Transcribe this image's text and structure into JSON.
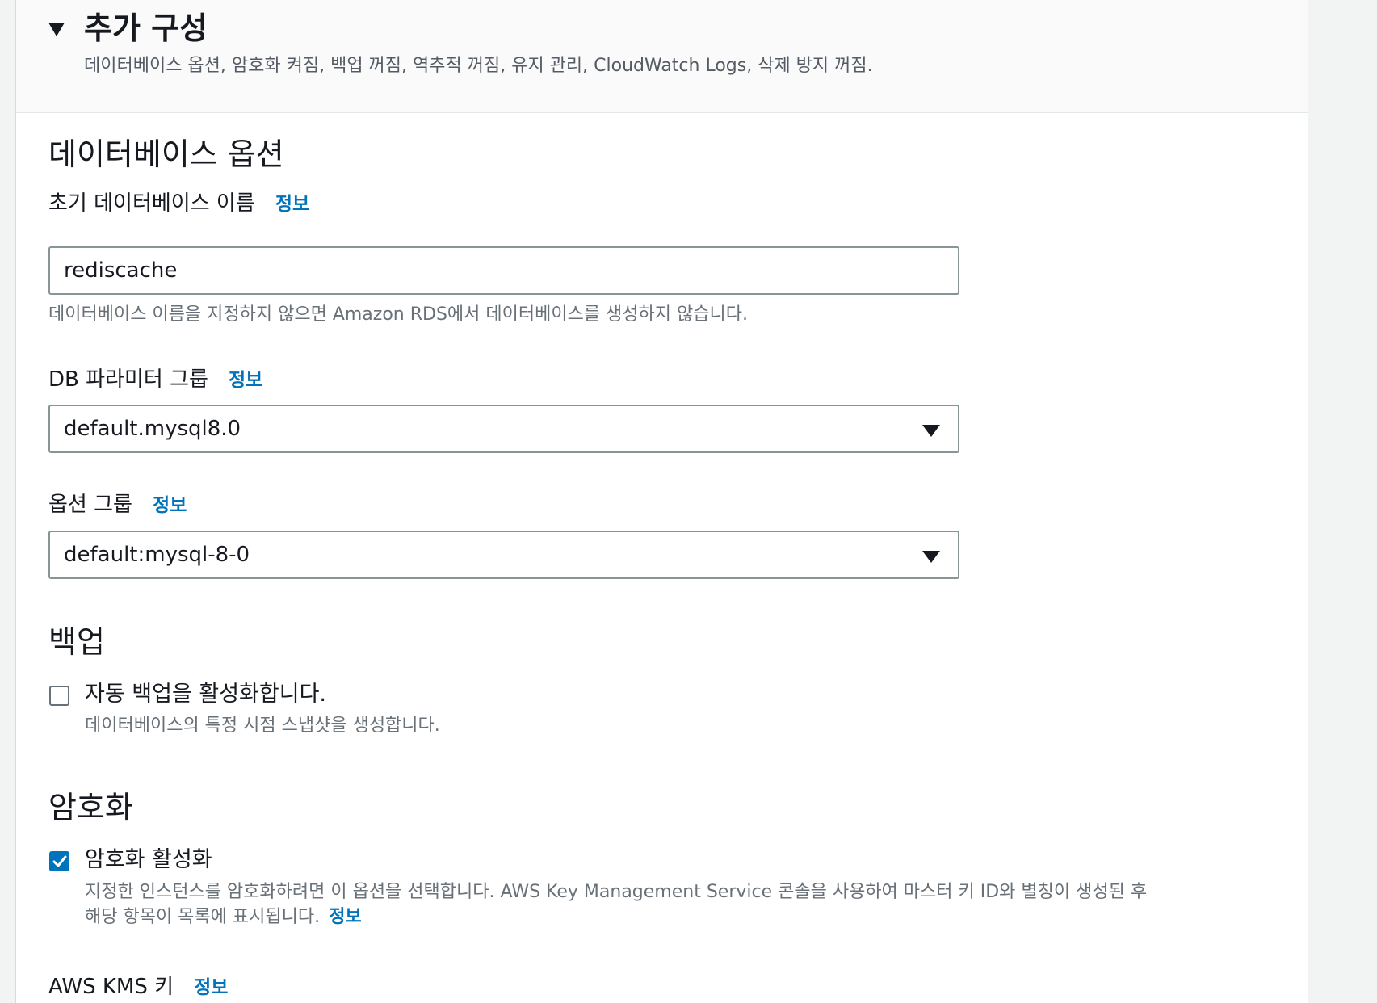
{
  "section": {
    "title": "추가 구성",
    "description": "데이터베이스 옵션, 암호화 켜짐, 백업 꺼짐, 역추적 꺼짐, 유지 관리, CloudWatch Logs, 삭제 방지 꺼짐."
  },
  "database_options": {
    "heading": "데이터베이스 옵션",
    "initial_db_name": {
      "label": "초기 데이터베이스 이름",
      "info": "정보",
      "value": "rediscache",
      "hint": "데이터베이스 이름을 지정하지 않으면 Amazon RDS에서 데이터베이스를 생성하지 않습니다."
    },
    "parameter_group": {
      "label": "DB 파라미터 그룹",
      "info": "정보",
      "selected": "default.mysql8.0"
    },
    "option_group": {
      "label": "옵션 그룹",
      "info": "정보",
      "selected": "default:mysql-8-0"
    }
  },
  "backup": {
    "heading": "백업",
    "checkbox_label": "자동 백업을 활성화합니다.",
    "checked": false,
    "hint": "데이터베이스의 특정 시점 스냅샷을 생성합니다."
  },
  "encryption": {
    "heading": "암호화",
    "checkbox_label": "암호화 활성화",
    "checked": true,
    "hint_line1": "지정한 인스턴스를 암호화하려면 이 옵션을 선택합니다. AWS Key Management Service 콘솔을 사용하여 마스터 키 ID와 별칭이 생성된 후",
    "hint_line2": "해당 항목이 목록에 표시됩니다.",
    "info": "정보"
  },
  "kms": {
    "label": "AWS KMS 키",
    "info": "정보"
  },
  "colors": {
    "link": "#0073bb",
    "checkbox_checked": "#0073bb",
    "border": "#879596"
  }
}
